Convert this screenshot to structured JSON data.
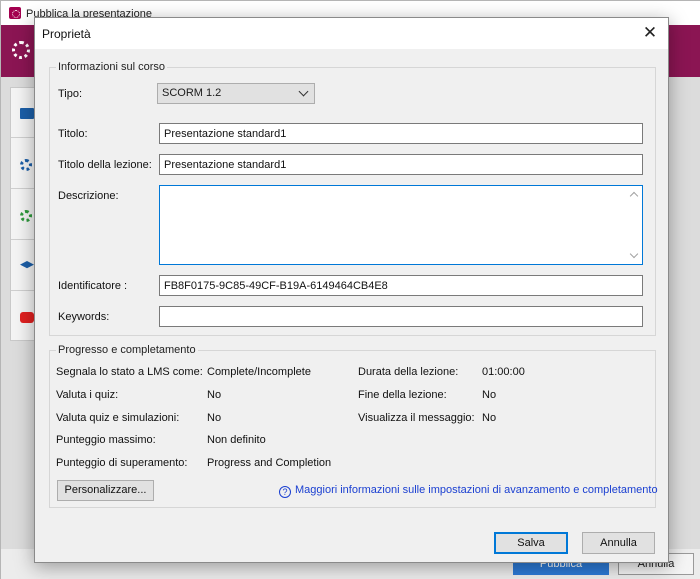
{
  "background_window": {
    "title": "Pubblica la presentazione",
    "publish_label": "Pubblica",
    "cancel_label": "Annulla"
  },
  "dialog": {
    "title": "Proprietà",
    "close_icon": "close-icon",
    "course_info": {
      "group_title": "Informazioni sul corso",
      "type_label": "Tipo:",
      "type_value": "SCORM 1.2",
      "title_label": "Titolo:",
      "title_value": "Presentazione standard1",
      "lesson_title_label": "Titolo della lezione:",
      "lesson_title_value": "Presentazione standard1",
      "description_label": "Descrizione:",
      "description_value": "",
      "identifier_label": "Identificatore :",
      "identifier_value": "FB8F0175-9C85-49CF-B19A-6149464CB4E8",
      "keywords_label": "Keywords:",
      "keywords_value": ""
    },
    "progress": {
      "group_title": "Progresso e completamento",
      "left": [
        {
          "label": "Segnala lo stato a LMS come:",
          "value": "Complete/Incomplete"
        },
        {
          "label": "Valuta  i quiz:",
          "value": "No"
        },
        {
          "label": "Valuta quiz e simulazioni:",
          "value": "No"
        },
        {
          "label": "Punteggio massimo:",
          "value": "Non definito"
        },
        {
          "label": "Punteggio di superamento:",
          "value": "Progress and Completion"
        }
      ],
      "right": [
        {
          "label": "Durata della lezione:",
          "value": "01:00:00"
        },
        {
          "label": "Fine della lezione:",
          "value": "No"
        },
        {
          "label": "Visualizza il  messaggio:",
          "value": "No"
        }
      ],
      "customize_label": "Personalizzare...",
      "info_link": "Maggiori informazioni sulle impostazioni di avanzamento e completamento"
    },
    "save_label": "Salva",
    "cancel_label": "Annulla"
  }
}
